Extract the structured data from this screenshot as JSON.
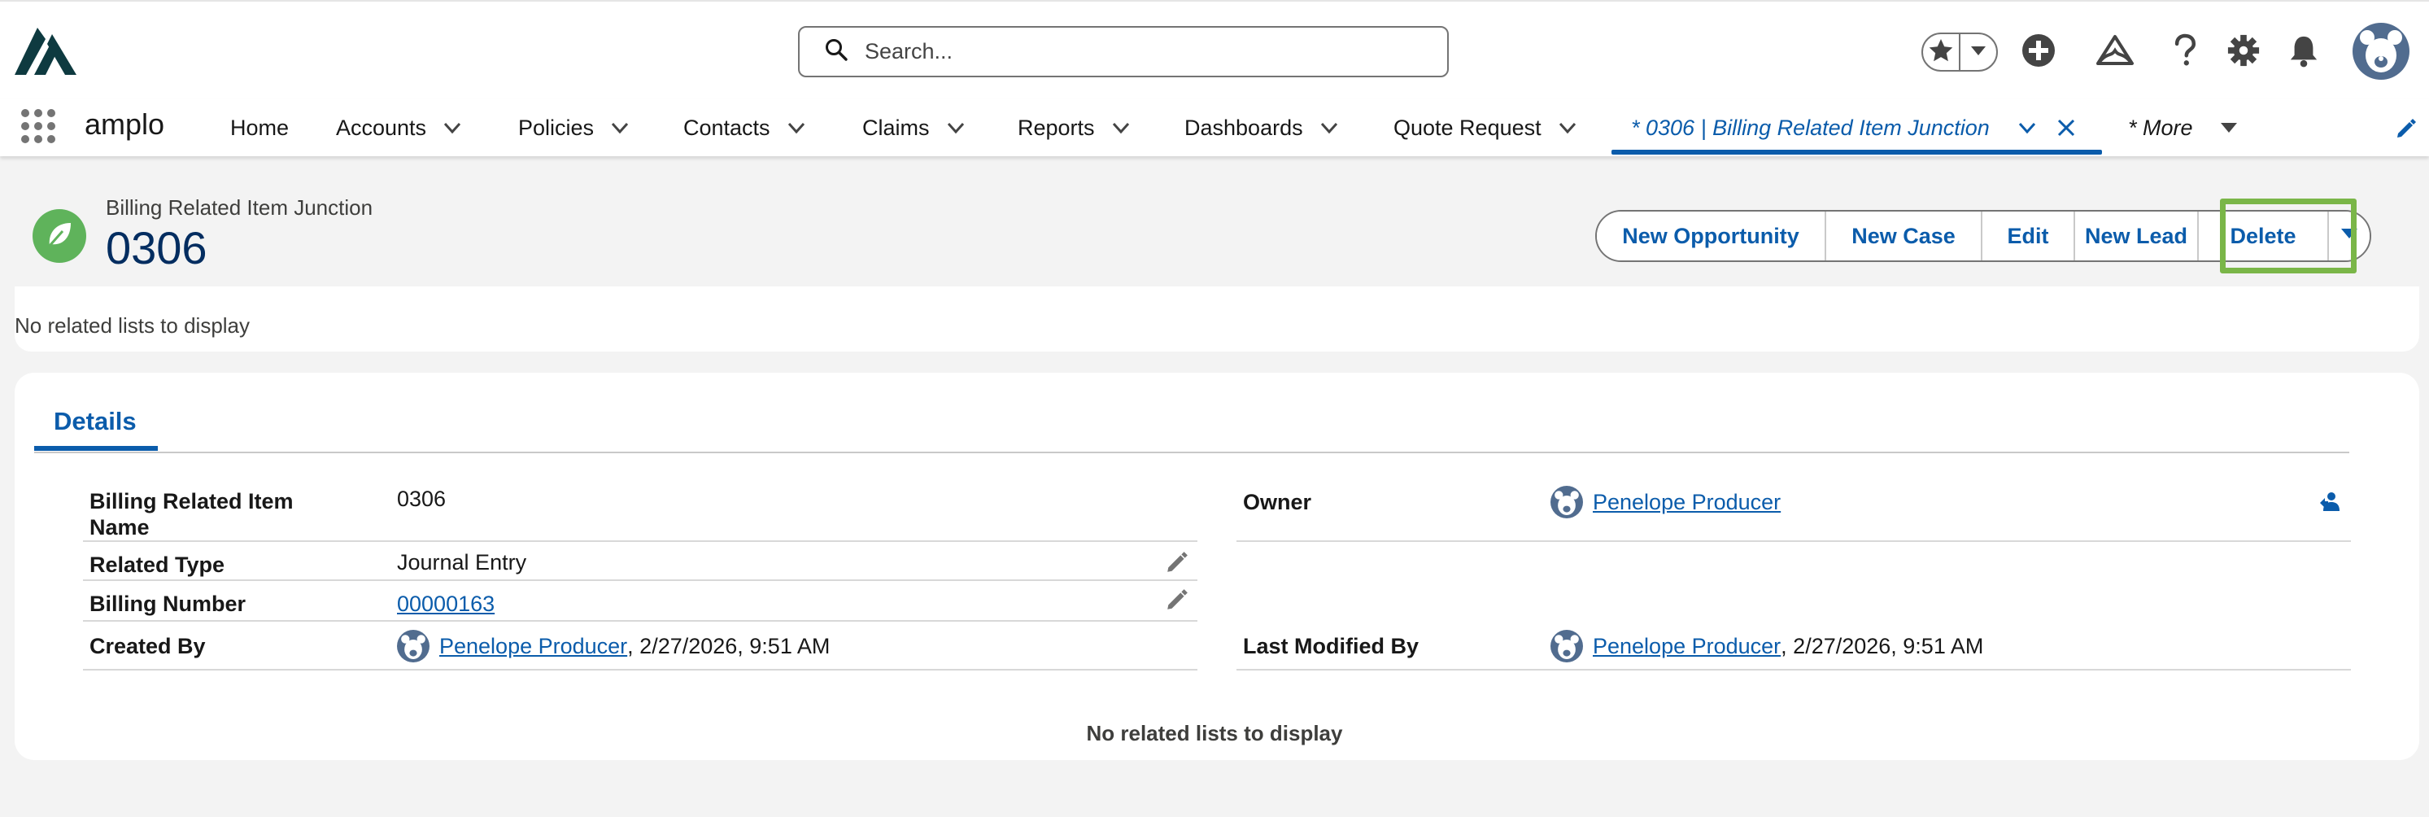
{
  "header": {
    "search_placeholder": "Search..."
  },
  "nav": {
    "app_name": "amplo",
    "items": [
      {
        "label": "Home"
      },
      {
        "label": "Accounts"
      },
      {
        "label": "Policies"
      },
      {
        "label": "Contacts"
      },
      {
        "label": "Claims"
      },
      {
        "label": "Reports"
      },
      {
        "label": "Dashboards"
      },
      {
        "label": "Quote Request"
      }
    ],
    "active_tab": "* 0306 | Billing Related Item Junction",
    "more": "* More"
  },
  "record": {
    "type_label": "Billing Related Item Junction",
    "name": "0306",
    "actions": [
      "New Opportunity",
      "New Case",
      "Edit",
      "New Lead",
      "Delete"
    ]
  },
  "related_strip": {
    "text": "No related lists to display"
  },
  "details": {
    "tab_label": "Details",
    "fields": {
      "item_name_label_1": "Billing Related Item",
      "item_name_label_2": "Name",
      "item_name_value": "0306",
      "related_type_label": "Related Type",
      "related_type_value": "Journal Entry",
      "billing_number_label": "Billing Number",
      "billing_number_value": "00000163",
      "created_by_label": "Created By",
      "created_by_user": "Penelope Producer",
      "created_by_date": ", 2/27/2026, 9:51 AM",
      "owner_label": "Owner",
      "owner_user": "Penelope Producer",
      "last_modified_label": "Last Modified By",
      "last_modified_user": "Penelope Producer",
      "last_modified_date": ", 2/27/2026, 9:51 AM"
    },
    "footer_text": "No related lists to display"
  },
  "colors": {
    "brand_blue": "#0b5cab",
    "title_navy": "#032d60",
    "record_icon_green": "#5fb35b",
    "highlight_green": "#7ab648",
    "avatar_slate": "#516c8f"
  },
  "icons": {
    "logo": "amplo-logo",
    "search": "search-icon",
    "favorites": "star-icon",
    "favorites_menu": "chevron-down-icon",
    "global_actions": "plus-circle-icon",
    "trailhead": "trailhead-icon",
    "help": "help-icon",
    "setup": "gear-icon",
    "notifications": "bell-icon",
    "user": "bear-avatar-icon",
    "app_launcher": "waffle-icon",
    "edit_nav": "pencil-icon",
    "record_type": "leaf-icon",
    "change_owner": "change-owner-icon"
  }
}
